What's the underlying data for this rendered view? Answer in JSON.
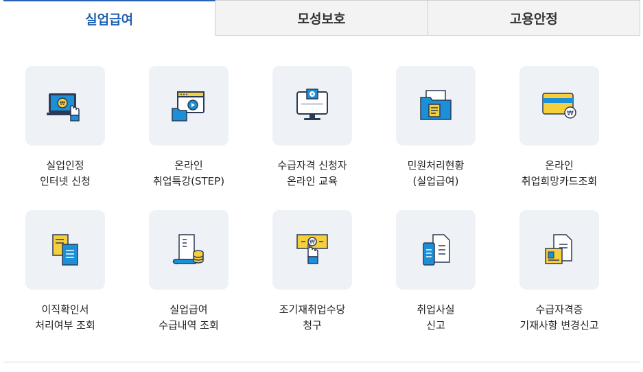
{
  "tabs": [
    {
      "label": "실업급여",
      "active": true
    },
    {
      "label": "모성보호",
      "active": false
    },
    {
      "label": "고용안정",
      "active": false
    }
  ],
  "colors": {
    "accent": "#1f5fb0",
    "tile_bg": "#eef2f7",
    "icon_blue": "#1b8fd8",
    "icon_yellow": "#f6cf3c",
    "icon_dark": "#2b3a55"
  },
  "items": [
    {
      "line1": "실업인정",
      "line2": "인터넷 신청",
      "icon": "laptop-hand-icon"
    },
    {
      "line1": "온라인",
      "line2": "취업특강(STEP)",
      "icon": "video-window-icon"
    },
    {
      "line1": "수급자격 신청자",
      "line2": "온라인 교육",
      "icon": "monitor-play-icon"
    },
    {
      "line1": "민원처리현황",
      "line2": "(실업급여)",
      "icon": "folder-document-icon"
    },
    {
      "line1": "온라인",
      "line2": "취업희망카드조회",
      "icon": "credit-card-icon"
    },
    {
      "line1": "이직확인서",
      "line2": "처리여부 조회",
      "icon": "documents-icon"
    },
    {
      "line1": "실업급여",
      "line2": "수급내역 조회",
      "icon": "receipt-coins-icon"
    },
    {
      "line1": "조기재취업수당",
      "line2": "청구",
      "icon": "bill-hand-icon"
    },
    {
      "line1": "취업사실",
      "line2": "신고",
      "icon": "phone-document-icon"
    },
    {
      "line1": "수급자격증",
      "line2": "기재사항 변경신고",
      "icon": "id-document-icon"
    }
  ]
}
